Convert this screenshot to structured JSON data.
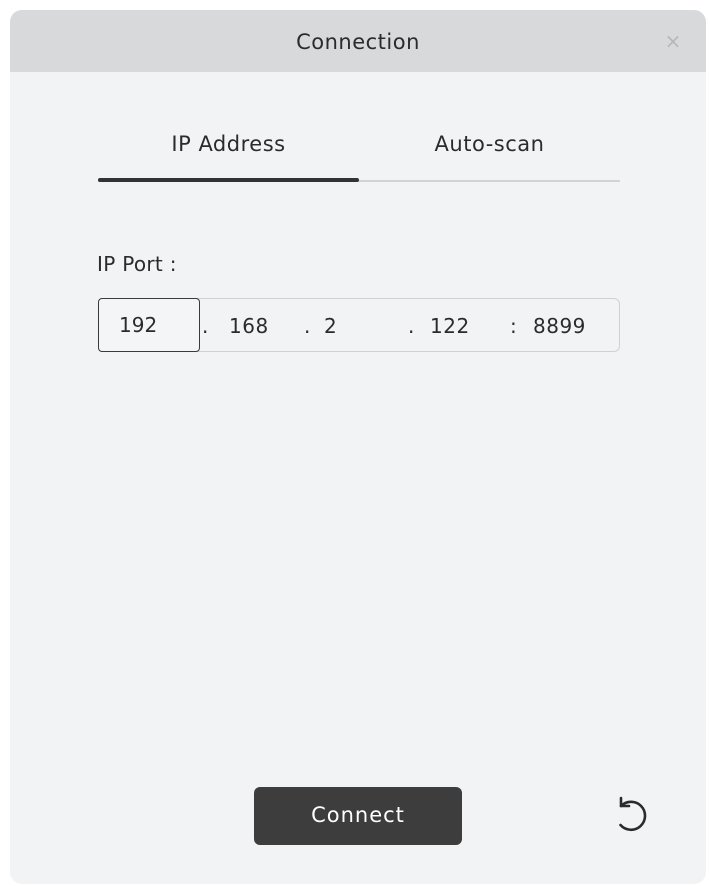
{
  "dialog": {
    "title": "Connection",
    "close_label": "×"
  },
  "tabs": [
    {
      "label": "IP Address",
      "active": true
    },
    {
      "label": "Auto-scan",
      "active": false
    }
  ],
  "ip_port": {
    "label": "IP Port :",
    "octets": [
      "192",
      "168",
      "2",
      "122"
    ],
    "dots": [
      ".",
      ".",
      "."
    ],
    "colon": ":",
    "port": "8899"
  },
  "footer": {
    "connect_label": "Connect",
    "refresh_icon": "refresh-icon"
  },
  "colors": {
    "titlebar": "#d8d9db",
    "body": "#f2f3f5",
    "button": "#3d3d3d",
    "tab_indicator": "#333333"
  }
}
